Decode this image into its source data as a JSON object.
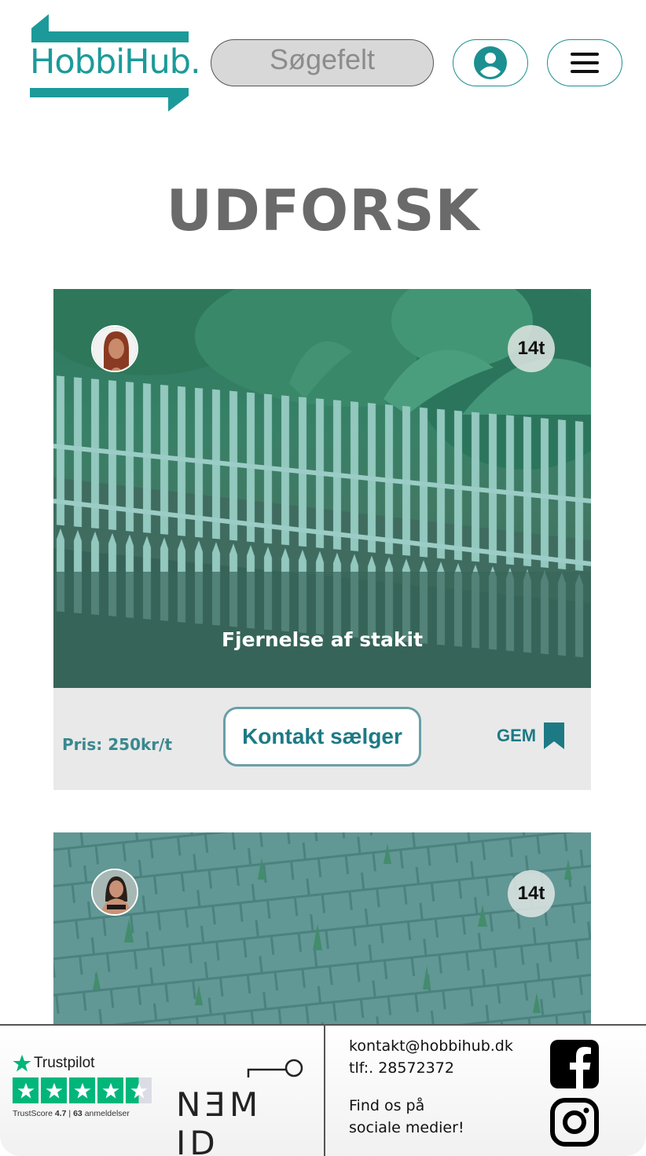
{
  "header": {
    "logo_text": "HobbiHub.",
    "search_placeholder": "Søgefelt",
    "user_icon": "user-icon",
    "menu_icon": "hamburger-menu-icon"
  },
  "page": {
    "title": "UDFORSK"
  },
  "cards": [
    {
      "title": "Fjernelse af stakit",
      "time": "14t",
      "price": "Pris: 250kr/t",
      "contact_label": "Kontakt sælger",
      "save_label": "GEM"
    },
    {
      "time": "14t"
    }
  ],
  "footer": {
    "trustpilot": {
      "brand": "Trustpilot",
      "score_label": "TrustScore",
      "score": "4.7",
      "separator": "|",
      "reviews_count": "63",
      "reviews_label": "anmeldelser"
    },
    "nemid_text": "NƎM ID",
    "email": "kontakt@hobbihub.dk",
    "phone": "tlf:. 28572372",
    "social_line1": "Find os på",
    "social_line2": "sociale medier!"
  },
  "colors": {
    "brand": "#1c9a9a",
    "accent": "#1d7a85",
    "image_overlay": "#2f8f8a",
    "trustpilot_green": "#00b67a"
  }
}
